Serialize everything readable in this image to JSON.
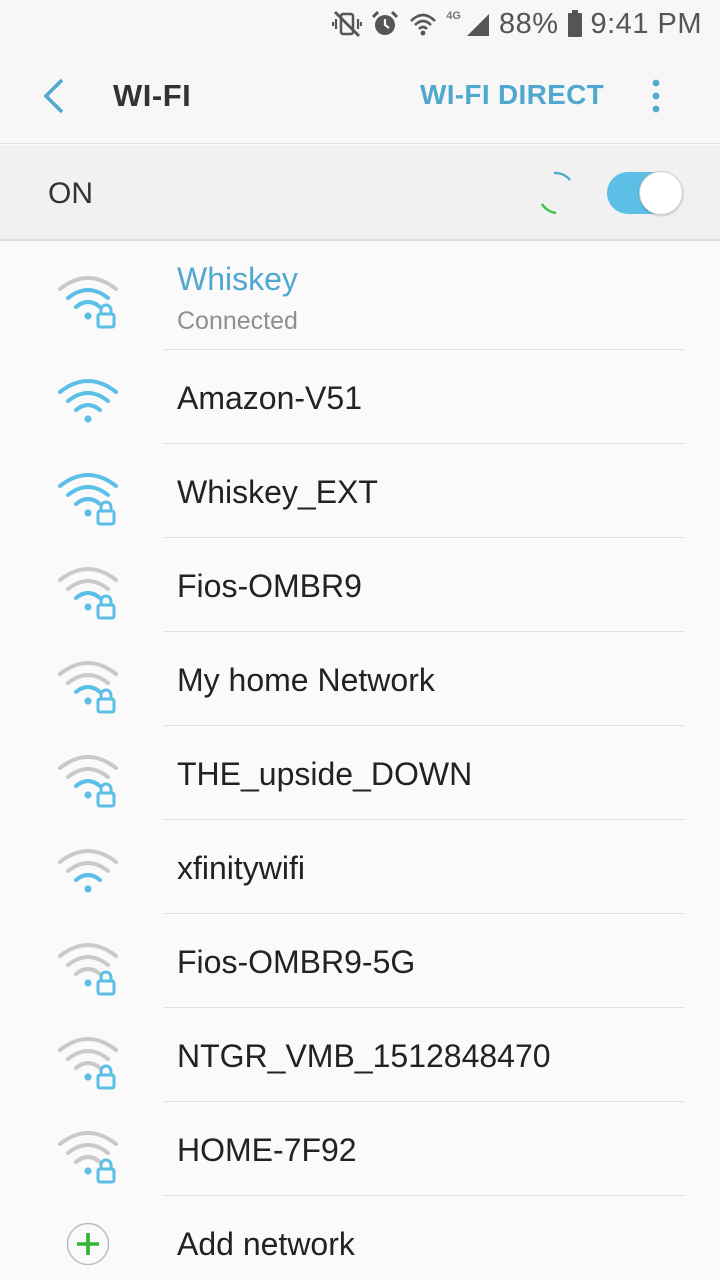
{
  "status_bar": {
    "battery": "88%",
    "time": "9:41 PM",
    "network_label": "4G",
    "icons": [
      "vibrate-mute-icon",
      "alarm-icon",
      "wifi-icon",
      "signal-icon",
      "battery-icon"
    ]
  },
  "app_bar": {
    "title": "WI-FI",
    "wifi_direct_label": "WI-FI DIRECT"
  },
  "toggle_row": {
    "label": "ON",
    "enabled": true
  },
  "colors": {
    "accent": "#4fa8cf",
    "toggle_on": "#5bbfe6",
    "signal_strong": "#5bbfe6",
    "signal_weak": "#c9c9c9"
  },
  "networks": [
    {
      "name": "Whiskey",
      "status": "Connected",
      "secured": true,
      "strength": 3
    },
    {
      "name": "Amazon-V51",
      "status": "",
      "secured": false,
      "strength": 4
    },
    {
      "name": "Whiskey_EXT",
      "status": "",
      "secured": true,
      "strength": 4
    },
    {
      "name": "Fios-OMBR9",
      "status": "",
      "secured": true,
      "strength": 2
    },
    {
      "name": "My home Network",
      "status": "",
      "secured": true,
      "strength": 2
    },
    {
      "name": "THE_upside_DOWN",
      "status": "",
      "secured": true,
      "strength": 2
    },
    {
      "name": "xfinitywifi",
      "status": "",
      "secured": false,
      "strength": 2
    },
    {
      "name": "Fios-OMBR9-5G",
      "status": "",
      "secured": true,
      "strength": 1
    },
    {
      "name": "NTGR_VMB_1512848470",
      "status": "",
      "secured": true,
      "strength": 1
    },
    {
      "name": "HOME-7F92",
      "status": "",
      "secured": true,
      "strength": 1
    }
  ],
  "add_network_label": "Add network"
}
